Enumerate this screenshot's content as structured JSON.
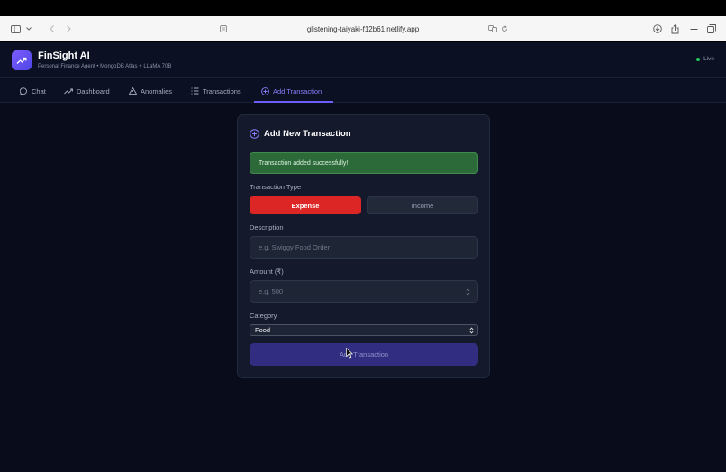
{
  "browser": {
    "url": "glistening-taiyaki-f12b61.netlify.app"
  },
  "app": {
    "title": "FinSight AI",
    "subtitle": "Personal Finance Agent • MongoDB Atlas + LLaMA 70B",
    "status": "Live"
  },
  "tabs": [
    {
      "label": "Chat",
      "icon": "chat-icon"
    },
    {
      "label": "Dashboard",
      "icon": "trend-icon"
    },
    {
      "label": "Anomalies",
      "icon": "warning-icon"
    },
    {
      "label": "Transactions",
      "icon": "list-icon"
    },
    {
      "label": "Add Transaction",
      "icon": "plus-circle-icon",
      "active": true
    }
  ],
  "form": {
    "title": "Add New Transaction",
    "success_message": "Transaction added successfully!",
    "type_label": "Transaction Type",
    "type_options": [
      "Expense",
      "Income"
    ],
    "selected_type": "Expense",
    "description_label": "Description",
    "description_placeholder": "e.g. Swiggy Food Order",
    "amount_label": "Amount (₹)",
    "amount_placeholder": "e.g. 500",
    "category_label": "Category",
    "category_value": "Food",
    "submit_label": "Add Transaction"
  },
  "colors": {
    "accent": "#6d5efc",
    "expense": "#dc2626",
    "success_bg": "#2d6a3a",
    "live": "#22c55e",
    "background": "#090d1b"
  }
}
